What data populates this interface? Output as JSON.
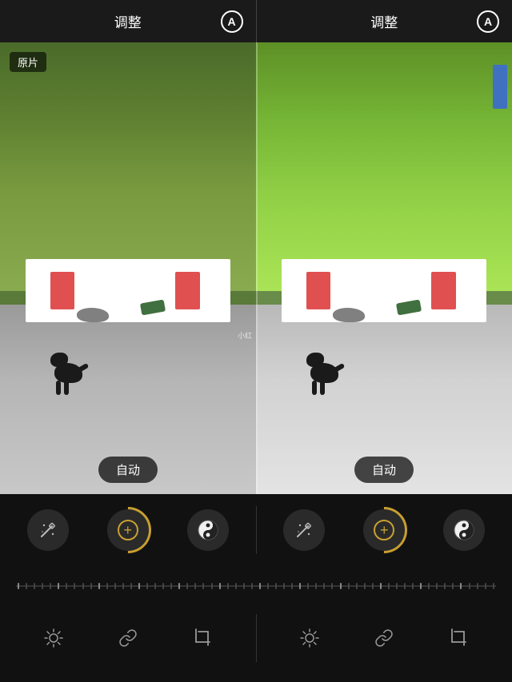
{
  "header": {
    "left": {
      "title": "调整",
      "icon_label": "A"
    },
    "right": {
      "title": "调整",
      "icon_label": "A"
    }
  },
  "image": {
    "original_label": "原片",
    "watermark": "小红",
    "auto_button": "自动"
  },
  "toolbar": {
    "icons": [
      {
        "name": "auto-enhance",
        "label": "自动增强"
      },
      {
        "name": "brightness-contrast",
        "label": "亮度对比"
      },
      {
        "name": "tone-curve",
        "label": "色调曲线"
      },
      {
        "name": "auto-enhance-2",
        "label": "自动增强2"
      },
      {
        "name": "brightness-contrast-2",
        "label": "亮度对比2"
      },
      {
        "name": "tone-curve-2",
        "label": "色调曲线2"
      }
    ],
    "bottom_icons": [
      {
        "name": "sun",
        "label": "亮度"
      },
      {
        "name": "link",
        "label": "链接"
      },
      {
        "name": "crop",
        "label": "裁剪"
      }
    ]
  }
}
